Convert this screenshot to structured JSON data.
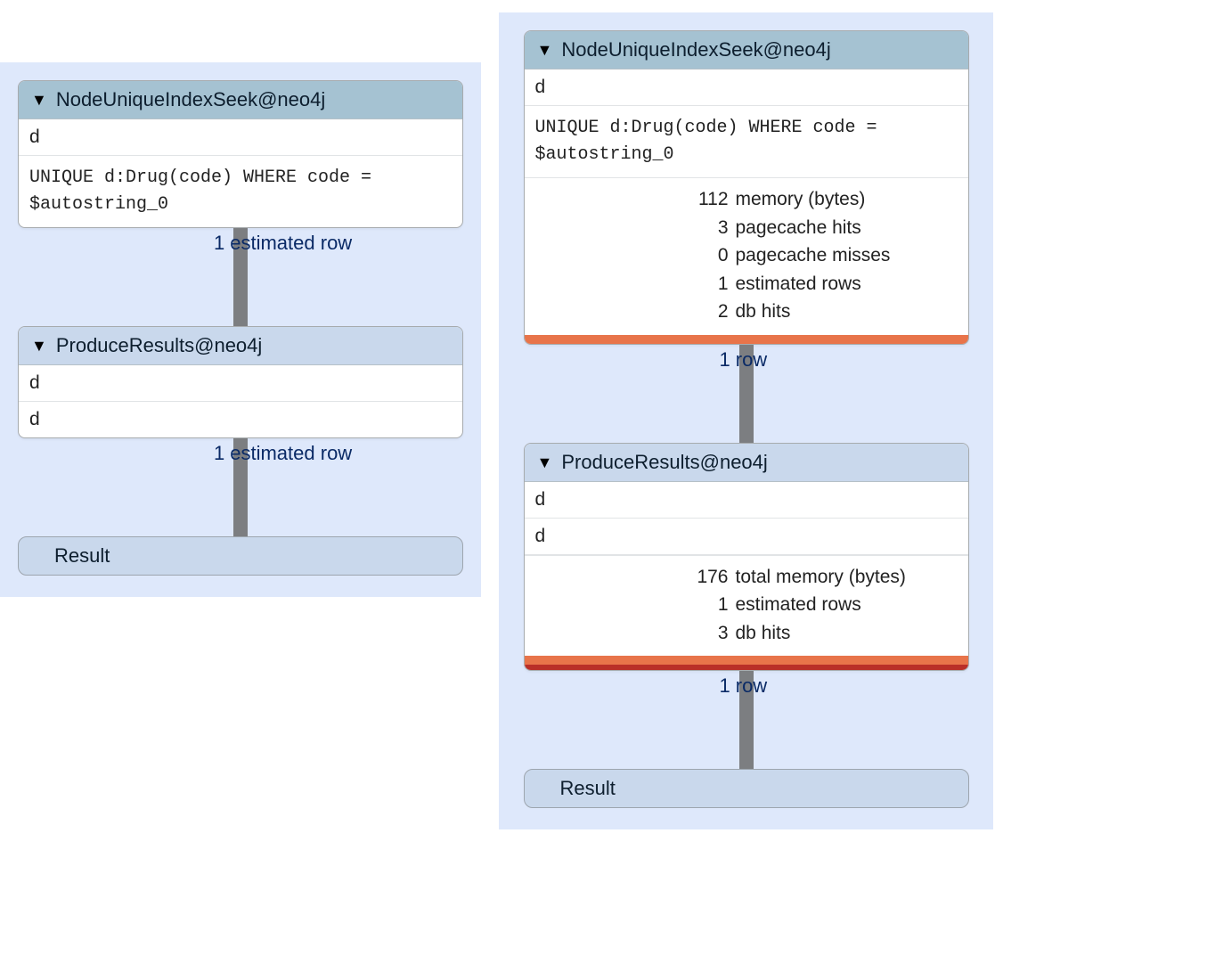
{
  "left": {
    "node1": {
      "title": "NodeUniqueIndexSeek@neo4j",
      "var": "d",
      "query": "UNIQUE d:Drug(code) WHERE code = $autostring_0"
    },
    "conn1": {
      "num": "1",
      "text": "estimated row"
    },
    "node2": {
      "title": "ProduceResults@neo4j",
      "row1": "d",
      "row2": "d"
    },
    "conn2": {
      "num": "1",
      "text": "estimated row"
    },
    "result": "Result"
  },
  "right": {
    "node1": {
      "title": "NodeUniqueIndexSeek@neo4j",
      "var": "d",
      "query": "UNIQUE d:Drug(code) WHERE code = $autostring_0",
      "stats": [
        {
          "n": "112",
          "t": "memory (bytes)"
        },
        {
          "n": "3",
          "t": "pagecache hits"
        },
        {
          "n": "0",
          "t": "pagecache misses"
        },
        {
          "n": "1",
          "t": "estimated rows"
        },
        {
          "n": "2",
          "t": "db hits"
        }
      ]
    },
    "conn1": {
      "num": "1",
      "text": "row"
    },
    "node2": {
      "title": "ProduceResults@neo4j",
      "row1": "d",
      "row2": "d",
      "stats": [
        {
          "n": "176",
          "t": "total memory (bytes)"
        },
        {
          "n": "1",
          "t": "estimated rows"
        },
        {
          "n": "3",
          "t": "db hits"
        }
      ]
    },
    "conn2": {
      "num": "1",
      "text": "row"
    },
    "result": "Result"
  }
}
